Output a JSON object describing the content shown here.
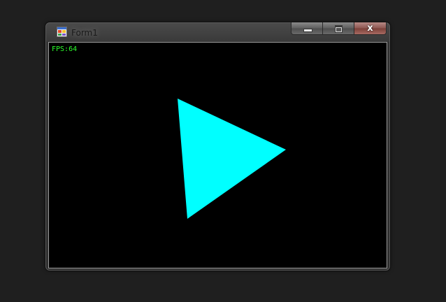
{
  "window": {
    "title": "Form1",
    "app_icon": "form-app-icon",
    "caption_buttons": {
      "minimize_icon": "minimize-icon",
      "maximize_icon": "maximize-icon",
      "close_label": "x"
    }
  },
  "canvas": {
    "fps_text": "FPS:64",
    "fps_color": "#2bff2b",
    "background_color": "#000000",
    "shape": {
      "type": "triangle",
      "fill_color": "#00ffff"
    }
  }
}
